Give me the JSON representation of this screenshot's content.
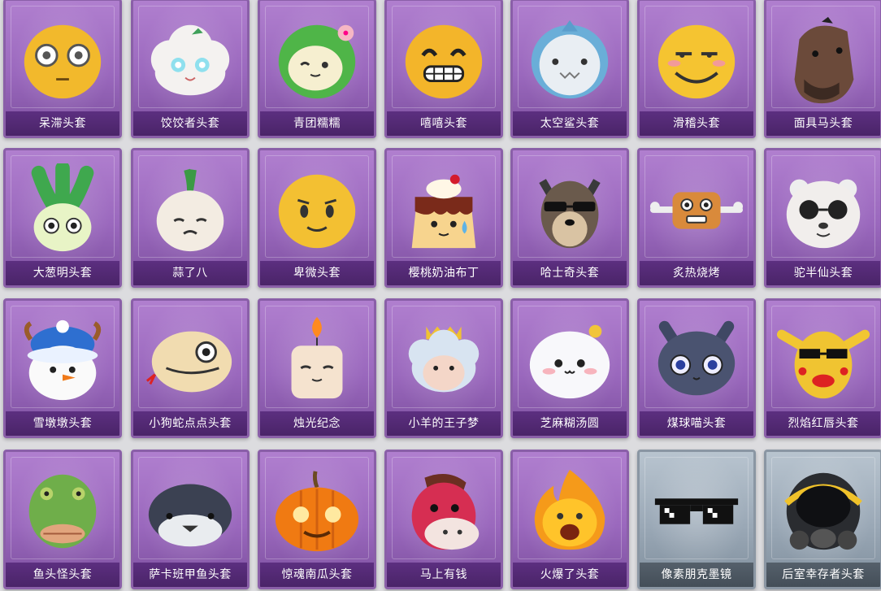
{
  "items": [
    {
      "label": "呆滞头套",
      "icon": "dazed-face-helmet-icon",
      "theme": "purple"
    },
    {
      "label": "饺饺者头套",
      "icon": "cloud-dumpling-helmet-icon",
      "theme": "purple"
    },
    {
      "label": "青团糯糯",
      "icon": "green-rice-ball-helmet-icon",
      "theme": "purple"
    },
    {
      "label": "嘻嘻头套",
      "icon": "grinning-face-helmet-icon",
      "theme": "purple"
    },
    {
      "label": "太空鲨头套",
      "icon": "space-shark-helmet-icon",
      "theme": "purple"
    },
    {
      "label": "滑稽头套",
      "icon": "funny-face-helmet-icon",
      "theme": "purple"
    },
    {
      "label": "面具马头套",
      "icon": "horse-mask-helmet-icon",
      "theme": "purple"
    },
    {
      "label": "大葱明头套",
      "icon": "scallion-helmet-icon",
      "theme": "purple"
    },
    {
      "label": "蒜了八",
      "icon": "garlic-helmet-icon",
      "theme": "purple"
    },
    {
      "label": "卑微头套",
      "icon": "humble-face-helmet-icon",
      "theme": "purple"
    },
    {
      "label": "樱桃奶油布丁",
      "icon": "cherry-pudding-helmet-icon",
      "theme": "purple"
    },
    {
      "label": "哈士奇头套",
      "icon": "husky-helmet-icon",
      "theme": "purple"
    },
    {
      "label": "炙热烧烤",
      "icon": "grilled-meat-helmet-icon",
      "theme": "purple"
    },
    {
      "label": "驼半仙头套",
      "icon": "alpaca-helmet-icon",
      "theme": "purple"
    },
    {
      "label": "雪墩墩头套",
      "icon": "snowman-helmet-icon",
      "theme": "purple"
    },
    {
      "label": "小狗蛇点点头套",
      "icon": "snake-helmet-icon",
      "theme": "purple"
    },
    {
      "label": "烛光纪念",
      "icon": "candle-helmet-icon",
      "theme": "purple"
    },
    {
      "label": "小羊的王子梦",
      "icon": "sheep-prince-helmet-icon",
      "theme": "purple"
    },
    {
      "label": "芝麻糊汤圆",
      "icon": "rice-dumpling-helmet-icon",
      "theme": "purple"
    },
    {
      "label": "煤球喵头套",
      "icon": "black-cat-helmet-icon",
      "theme": "purple"
    },
    {
      "label": "烈焰红唇头套",
      "icon": "yellow-mask-helmet-icon",
      "theme": "purple"
    },
    {
      "label": "鱼头怪头套",
      "icon": "fish-head-helmet-icon",
      "theme": "purple"
    },
    {
      "label": "萨卡班甲鱼头套",
      "icon": "armored-fish-helmet-icon",
      "theme": "purple"
    },
    {
      "label": "惊魂南瓜头套",
      "icon": "pumpkin-helmet-icon",
      "theme": "purple"
    },
    {
      "label": "马上有钱",
      "icon": "red-horse-helmet-icon",
      "theme": "purple"
    },
    {
      "label": "火爆了头套",
      "icon": "fire-helmet-icon",
      "theme": "purple"
    },
    {
      "label": "像素朋克墨镜",
      "icon": "pixel-sunglasses-icon",
      "theme": "gray"
    },
    {
      "label": "后室幸存者头套",
      "icon": "gas-mask-helmet-icon",
      "theme": "gray"
    }
  ]
}
